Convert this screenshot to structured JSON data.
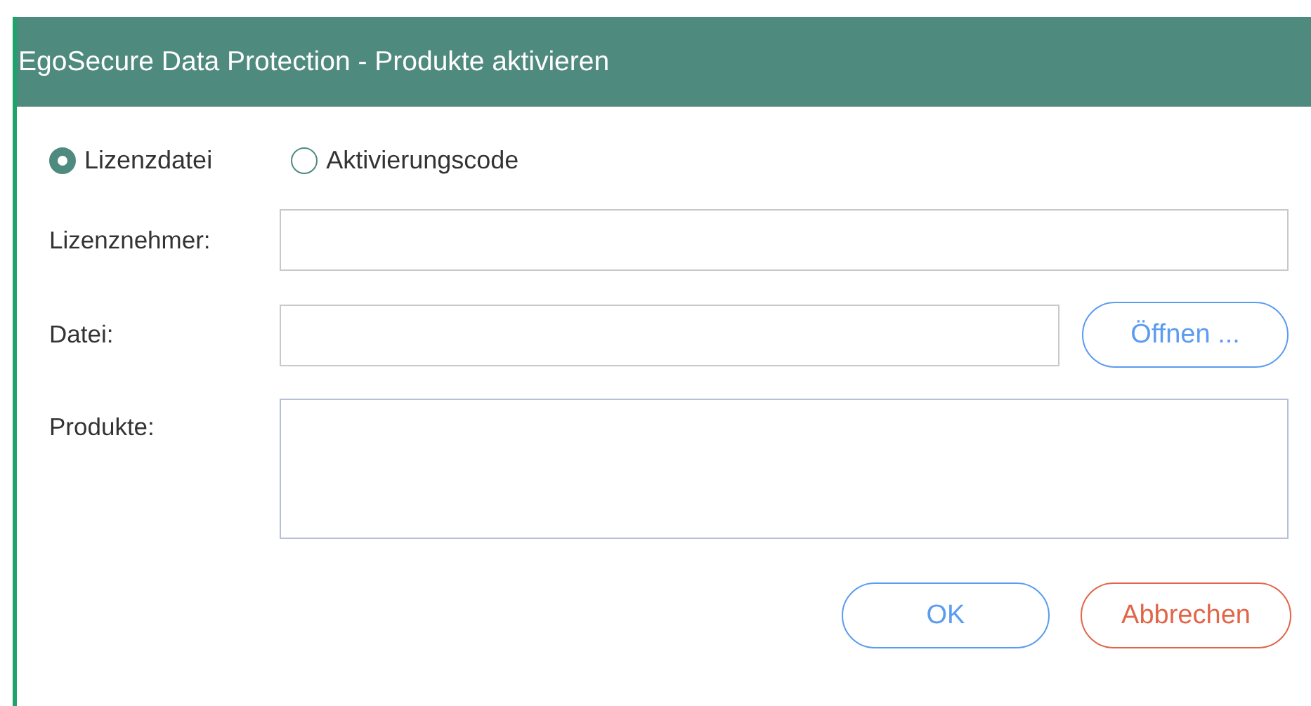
{
  "window": {
    "title": "EgoSecure Data Protection - Produkte aktivieren"
  },
  "source_options": [
    {
      "label": "Lizenzdatei",
      "selected": true
    },
    {
      "label": "Aktivierungscode",
      "selected": false
    }
  ],
  "fields": [
    {
      "kind": "text",
      "label": "Lizenznehmer:"
    },
    {
      "kind": "file",
      "label": "Datei:",
      "button": "Öffnen ..."
    },
    {
      "kind": "multiline",
      "label": "Produkte:"
    }
  ],
  "buttons": [
    {
      "label": "OK",
      "kind": "primary"
    },
    {
      "label": "Abbrechen",
      "kind": "cancel"
    }
  ]
}
